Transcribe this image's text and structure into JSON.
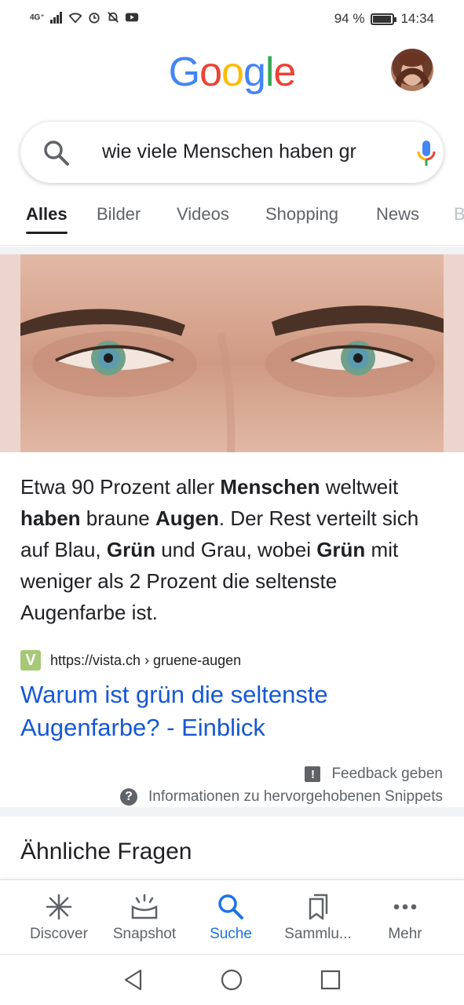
{
  "status_bar": {
    "network": "4G⁺",
    "battery_percent": "94 %",
    "battery_level": 0.94,
    "time": "14:34"
  },
  "header": {
    "logo_letters": [
      {
        "ch": "G",
        "color": "#4285F4"
      },
      {
        "ch": "o",
        "color": "#EA4335"
      },
      {
        "ch": "o",
        "color": "#FBBC05"
      },
      {
        "ch": "g",
        "color": "#4285F4"
      },
      {
        "ch": "l",
        "color": "#34A853"
      },
      {
        "ch": "e",
        "color": "#EA4335"
      }
    ],
    "avatar_icon": "profile-avatar"
  },
  "search": {
    "query": "wie viele Menschen haben gr",
    "search_icon": "search-icon",
    "mic_icon": "mic-icon"
  },
  "tabs": [
    {
      "label": "Alles",
      "active": true
    },
    {
      "label": "Bilder",
      "active": false
    },
    {
      "label": "Videos",
      "active": false
    },
    {
      "label": "Shopping",
      "active": false
    },
    {
      "label": "News",
      "active": false
    },
    {
      "label": "B",
      "active": false
    }
  ],
  "featured_snippet": {
    "image_alt": "eyes-image",
    "text_parts": [
      {
        "t": "Etwa 90 Prozent aller ",
        "b": false
      },
      {
        "t": "Menschen",
        "b": true
      },
      {
        "t": " weltweit ",
        "b": false
      },
      {
        "t": "haben",
        "b": true
      },
      {
        "t": " braune ",
        "b": false
      },
      {
        "t": "Augen",
        "b": true
      },
      {
        "t": ". Der Rest verteilt sich auf Blau, ",
        "b": false
      },
      {
        "t": "Grün",
        "b": true
      },
      {
        "t": " und Grau, wobei ",
        "b": false
      },
      {
        "t": "Grün",
        "b": true
      },
      {
        "t": " mit weniger als 2 Prozent die seltenste Augenfarbe ist.",
        "b": false
      }
    ],
    "favicon_letter": "V",
    "source_url": "https://vista.ch › gruene-augen",
    "link_title": "Warum ist grün die seltenste Augenfarbe? - Einblick",
    "feedback_label": "Feedback geben",
    "info_label": "Informationen zu hervorgehobenen Snippets",
    "info_icon_glyph": "?",
    "feedback_icon_glyph": "!"
  },
  "related": {
    "title": "Ähnliche Fragen"
  },
  "bottom_nav": [
    {
      "label": "Discover",
      "icon": "asterisk-icon",
      "active": false
    },
    {
      "label": "Snapshot",
      "icon": "snapshot-icon",
      "active": false
    },
    {
      "label": "Suche",
      "icon": "search-icon",
      "active": true
    },
    {
      "label": "Sammlu...",
      "icon": "collections-icon",
      "active": false
    },
    {
      "label": "Mehr",
      "icon": "more-icon",
      "active": false
    }
  ],
  "colors": {
    "link": "#1558d6",
    "active_nav": "#1a73e8",
    "secondary_text": "#5f6368"
  }
}
